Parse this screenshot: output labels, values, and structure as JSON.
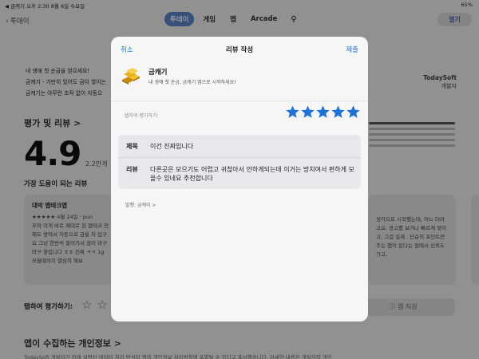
{
  "status_bar": {
    "left": "◀ 금캐기  오후 2:30  8월 6일 수요일",
    "right": "65%"
  },
  "nav": {
    "back_label": "투데이",
    "tabs": [
      "투데이",
      "게임",
      "앱",
      "Arcade"
    ],
    "open_button": "열기"
  },
  "page": {
    "news_lines": [
      "내 생애 첫 순금을 얻으세요!",
      "금캐기 - 가만히 있어도 금이 쌓이는",
      "금캐기는 아무런 조작 없이 자동으"
    ],
    "developer": "TodaySoft",
    "developer_role": "개발자",
    "ratings_title": "평가 및 리뷰 >",
    "rating_value": "4.9",
    "rating_count": "2.2만개",
    "helpful_title": "가장 도움이 되는 리뷰",
    "review_card_1": {
      "title": "대박 앱테크앱",
      "meta": "★★★★★ 4월 24일 · pun",
      "text": "우와 이게 바로 제대로 된 앱테크 안해도 쌓여서 자동으로 금을 처 입구요 그냥 한번씩 들어가서 금이 마구마구 쌓입니다 ㅎㅎ 진짜 ㅋㅋ 1g 모을때까지 열심히 해보"
    },
    "review_card_2": {
      "text": "생각으로 시작했는데, 어느 더라고요. 광고를 보거나 빠르게 쌓이고, 그걸 실제 . 단순히 포인트만 주는 앱이 된다는 점에서 신뢰도 가고,"
    },
    "tap_rate_label": "탭하여 평가하기:",
    "support_button": "앱 지원",
    "privacy_title": "앱이 수집하는 개인정보 >",
    "privacy_sub": "TodaySoft 개발자가 아래 설명된 데이터 처리 방식이 앱의 개인정보 처리방침에 포함될 수 있다고 표시했습니다. 자세한 내용은 개발자의 개인"
  },
  "modal": {
    "cancel": "취소",
    "title": "리뷰 작성",
    "submit": "제출",
    "app_name": "금캐기",
    "app_subtitle": "내 생애 첫 순금, 금캐기 앱으로 시작하세요!",
    "rate_label": "탭하여 평가하기:",
    "rating": 5,
    "form": {
      "title_label": "제목",
      "title_value": "이건 진짜입니다",
      "body_label": "리뷰",
      "body_value": "다른곳은 모으기도 어렵고 귀찮아서 안하게되는데 이거는 방치여서 편하게 모을수 있네요 추천합니다"
    },
    "posted_as": "발행: 금캐이 >"
  },
  "colors": {
    "accent": "#1d72d8",
    "nav_active": "#5a86c8",
    "gold": "#e0a818"
  }
}
